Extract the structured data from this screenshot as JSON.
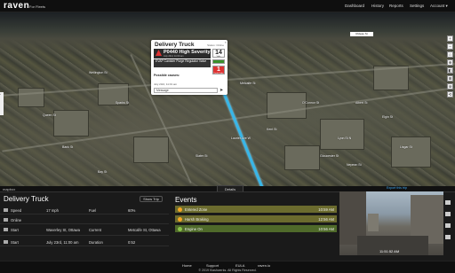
{
  "app": {
    "logo": "raven",
    "logo_sub": "For Fleets"
  },
  "nav": {
    "dashboard": "Dashboard",
    "history": "History",
    "reports": "Reports",
    "settings": "Settings",
    "account": "Account ▾"
  },
  "map": {
    "tag": "Rideau St",
    "labels": [
      "Queen St",
      "Wellington St",
      "Metcalfe St",
      "O'Connor St",
      "Kent St",
      "Sparks St",
      "Albert St",
      "Slater St",
      "Laurier Ave W",
      "Bank St",
      "Lyon St N",
      "Elgin St",
      "Lisgar St",
      "Gloucester St",
      "Nepean St",
      "Bay St"
    ],
    "popup": {
      "title": "Delivery Truck",
      "status": "Status: Online",
      "close": "×",
      "code": "P0440",
      "severity": "High Severity",
      "code_sub": "July 23rd, 11:00 am",
      "description": "EVAP Canister Purge Regulator Valve",
      "gauge_top": "14",
      "gauge_top_unit": "Volts",
      "gauge_bottom": "1",
      "gauge_bottom_unit": "Fault Code",
      "causes_label": "Possible causes:",
      "time": "July 23rd, 11:01 am",
      "message_placeholder": "Message",
      "send_icon": "➤"
    },
    "tools": [
      "+",
      "−",
      "⌂",
      "⊕",
      "◧",
      "⊞",
      "⊚",
      "⟲"
    ],
    "left_tab": "‹",
    "attribution": "mapbox"
  },
  "details_tab": "Details",
  "export": "Export this trip",
  "panel": {
    "title": "Delivery Truck",
    "show_trip": "Show Trip",
    "rows": [
      {
        "icon": "speed-icon",
        "label": "Speed",
        "value": "17 mph",
        "label2": "Fuel",
        "value2": "60%"
      },
      {
        "icon": "online-icon",
        "label": "Online",
        "value": "",
        "label2": "",
        "value2": ""
      },
      {
        "icon": "start-icon",
        "label": "Start",
        "value": "Waverley St, Ottawa",
        "label2": "Current",
        "value2": "Metcalfe St, Ottawa"
      },
      {
        "icon": "clock-icon",
        "label": "Start",
        "value": "July 23rd, 11:00 am",
        "label2": "Duration",
        "value2": "0:52"
      }
    ]
  },
  "events": {
    "title": "Events",
    "items": [
      {
        "label": "Entered Zone",
        "time": "10:59 AM"
      },
      {
        "label": "Harsh Braking",
        "time": "12:56 AM"
      },
      {
        "label": "Engine On",
        "time": "10:56 AM"
      }
    ]
  },
  "camera": {
    "timestamp": "11:51:52 AM"
  },
  "footer": {
    "home": "Home",
    "support": "Support",
    "eula": "EULA",
    "raven": "raven.io",
    "copyright": "© 2019 Klashwerks. All Rights Reserved."
  },
  "colors": {
    "route": "#38b6e8",
    "event_bg": "#6b6b2e",
    "event_dot": "#f5a623",
    "alert": "#d33333",
    "accent": "#3fa9f5"
  }
}
